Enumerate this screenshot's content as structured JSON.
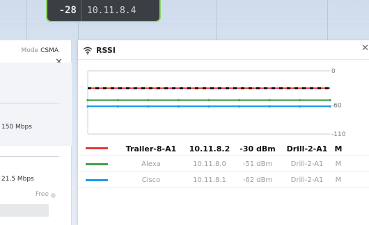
{
  "node_chip": {
    "rssi": "-28",
    "ip": "10.11.8.4"
  },
  "left_panel": {
    "mode_label": "Mode",
    "mode_value": "CSMA",
    "close": "✕",
    "rate_1": "150 Mbps",
    "rate_2": "21.5 Mbps",
    "free_label": "Free"
  },
  "rssi_panel": {
    "icon": "wifi-icon",
    "title": "RSSI",
    "close": "✕"
  },
  "chart_data": {
    "type": "line",
    "title": "RSSI",
    "xlabel": "",
    "ylabel": "",
    "ylim": [
      -110,
      0
    ],
    "y_ticks": [
      "0",
      "-60",
      "-110"
    ],
    "x": [
      0,
      1,
      2,
      3,
      4,
      5,
      6,
      7,
      8,
      9,
      10,
      11,
      12,
      13,
      14,
      15,
      16,
      17,
      18,
      19,
      20,
      21,
      22,
      23,
      24
    ],
    "series": [
      {
        "name": "Trailer-8-A1",
        "color": "#e53935",
        "style": "dashed-black-overlay",
        "values": [
          -30,
          -30,
          -30,
          -30,
          -30,
          -30,
          -30,
          -30,
          -30,
          -30,
          -30,
          -30,
          -30,
          -30,
          -30,
          -30,
          -30,
          -30,
          -30,
          -30,
          -30,
          -30,
          -30,
          -30,
          -30
        ]
      },
      {
        "name": "Alexa",
        "color": "#43a047",
        "values": [
          -51,
          -51,
          -51,
          -51,
          -51,
          -51,
          -51,
          -51,
          -51,
          -51,
          -51,
          -51,
          -51,
          -51,
          -51,
          -51,
          -51,
          -51,
          -51,
          -51,
          -51,
          -51,
          -51,
          -51,
          -51
        ]
      },
      {
        "name": "Cisco",
        "color": "#1e9be8",
        "values": [
          -62,
          -62,
          -62,
          -62,
          -62,
          -62,
          -62,
          -62,
          -62,
          -62,
          -62,
          -62,
          -62,
          -62,
          -62,
          -62,
          -62,
          -62,
          -62,
          -62,
          -62,
          -62,
          -62,
          -62,
          -62
        ]
      }
    ],
    "legend_placement": "bottom",
    "grid": false
  },
  "legend": [
    {
      "color": "#e53935",
      "name": "Trailer-8-A1",
      "ip": "10.11.8.2",
      "dbm": "-30 dBm",
      "node": "Drill-2-A1",
      "mode": "M",
      "primary": true
    },
    {
      "color": "#43a047",
      "name": "Alexa",
      "ip": "10.11.8.0",
      "dbm": "-51 dBm",
      "node": "Drill-2-A1",
      "mode": "M",
      "primary": false
    },
    {
      "color": "#1e9be8",
      "name": "Cisco",
      "ip": "10.11.8.1",
      "dbm": "-62 dBm",
      "node": "Drill-2-A1",
      "mode": "M",
      "primary": false
    }
  ]
}
